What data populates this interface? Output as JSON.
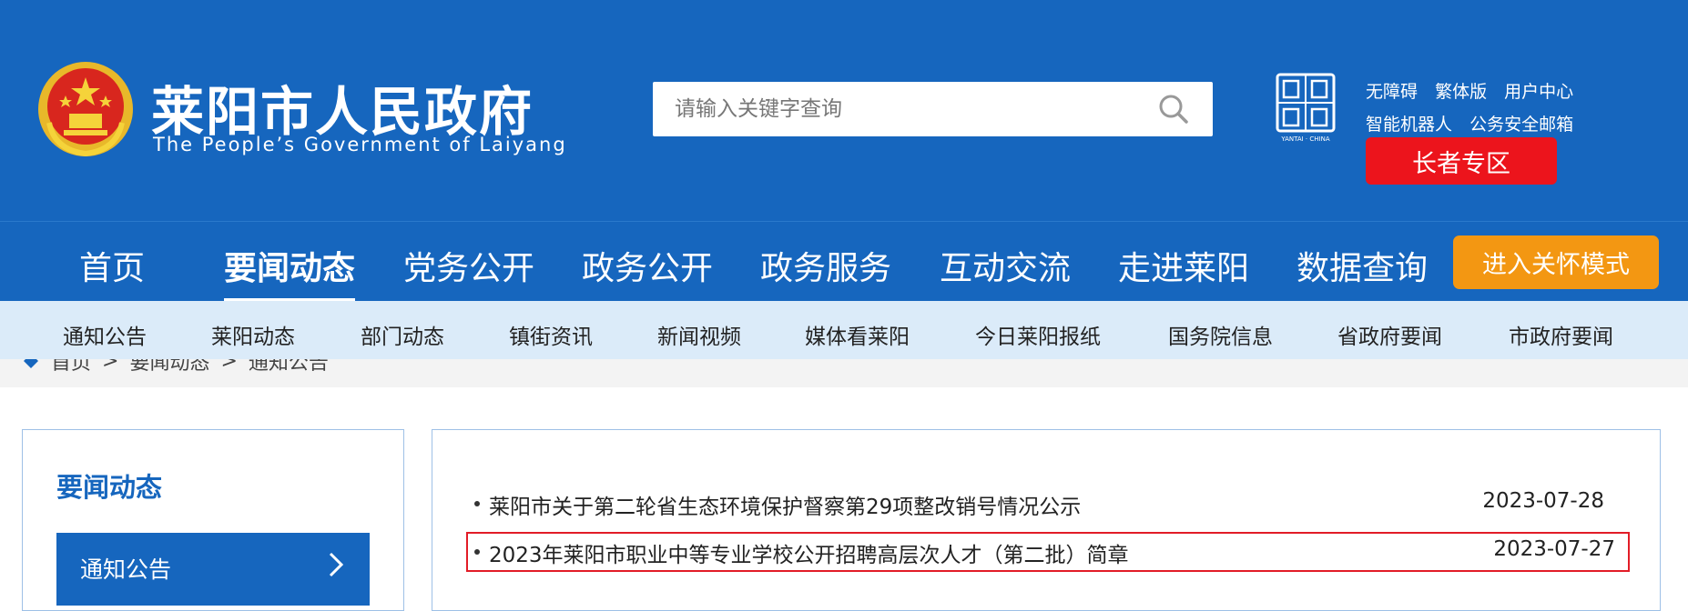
{
  "header": {
    "title": "莱阳市人民政府",
    "subtitle": "The People’s Government of Laiyang",
    "search": {
      "placeholder": "请输入关键字查询"
    },
    "seal_label": "YANTAI · CHINA",
    "top_links_row1": [
      "无障碍",
      "繁体版",
      "用户中心"
    ],
    "top_links_row2": [
      "智能机器人",
      "公务安全邮箱"
    ],
    "elder_zone": "长者专区"
  },
  "nav": {
    "items": [
      "首页",
      "要闻动态",
      "党务公开",
      "政务公开",
      "政务服务",
      "互动交流",
      "走进莱阳",
      "数据查询"
    ],
    "active_index": 1,
    "care_mode": "进入关怀模式"
  },
  "subnav": {
    "items": [
      "通知公告",
      "莱阳动态",
      "部门动态",
      "镇街资讯",
      "新闻视频",
      "媒体看莱阳",
      "今日莱阳报纸",
      "国务院信息",
      "省政府要闻",
      "市政府要闻"
    ]
  },
  "breadcrumb": [
    "首页",
    "要闻动态",
    "通知公告"
  ],
  "sidebar": {
    "title": "要闻动态",
    "item": "通知公告"
  },
  "list": {
    "items": [
      {
        "title": "莱阳市关于第二轮省生态环境保护督察第29项整改销号情况公示",
        "date": "2023-07-28"
      },
      {
        "title": "2023年莱阳市职业中等专业学校公开招聘高层次人才（第二批）简章",
        "date": "2023-07-27",
        "highlighted": true
      }
    ]
  },
  "colors": {
    "brand_blue": "#1666be",
    "red": "#ec141c",
    "orange": "#f39712",
    "subnav_bg": "#dbebf9"
  }
}
